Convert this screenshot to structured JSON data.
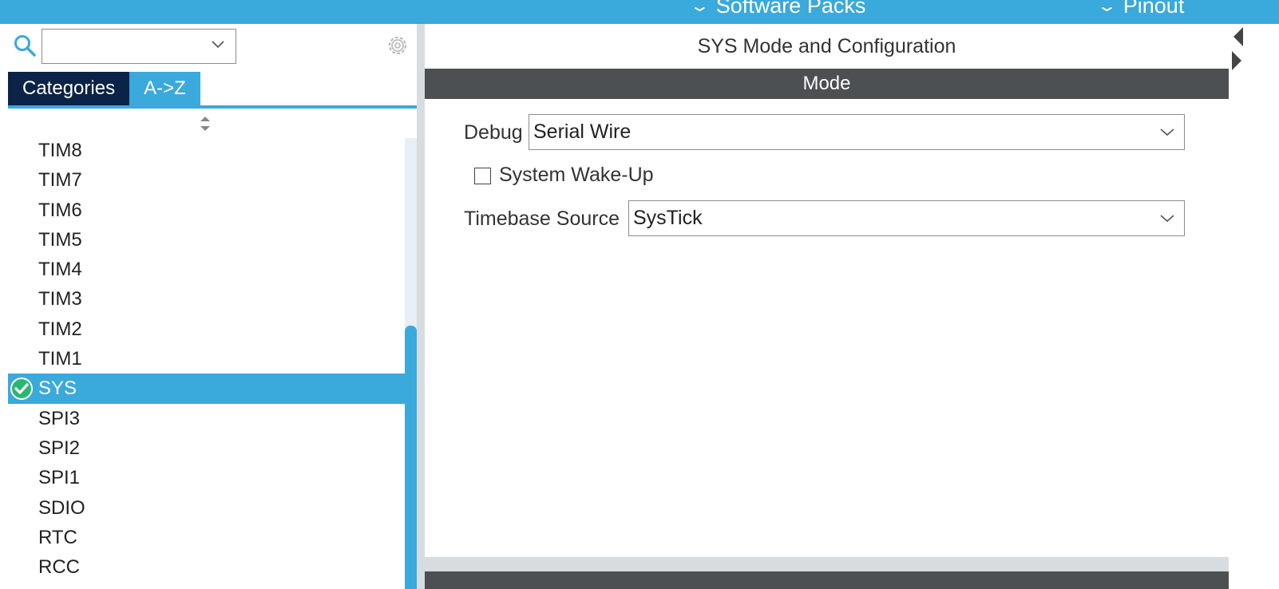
{
  "topbar": {
    "menus": [
      {
        "label": "Software Packs"
      },
      {
        "label": "Pinout"
      }
    ]
  },
  "left_panel": {
    "search": {
      "value": ""
    },
    "tabs": [
      {
        "label": "Categories"
      },
      {
        "label": "A->Z"
      }
    ],
    "items": [
      {
        "label": "TIM8"
      },
      {
        "label": "TIM7"
      },
      {
        "label": "TIM6"
      },
      {
        "label": "TIM5"
      },
      {
        "label": "TIM4"
      },
      {
        "label": "TIM3"
      },
      {
        "label": "TIM2"
      },
      {
        "label": "TIM1"
      },
      {
        "label": "SYS"
      },
      {
        "label": "SPI3"
      },
      {
        "label": "SPI2"
      },
      {
        "label": "SPI1"
      },
      {
        "label": "SDIO"
      },
      {
        "label": "RTC"
      },
      {
        "label": "RCC"
      }
    ],
    "selected_item": "SYS"
  },
  "right_panel": {
    "title": "SYS Mode and Configuration",
    "section": "Mode",
    "debug": {
      "label": "Debug",
      "value": "Serial Wire"
    },
    "wakeup": {
      "label": "System Wake-Up",
      "checked": false
    },
    "timebase": {
      "label": "Timebase Source",
      "value": "SysTick"
    }
  },
  "colors": {
    "accent": "#3aa9dc",
    "tab_dark": "#0b2347",
    "mode_bar": "#4d5052",
    "check_green": "#2bb673"
  }
}
